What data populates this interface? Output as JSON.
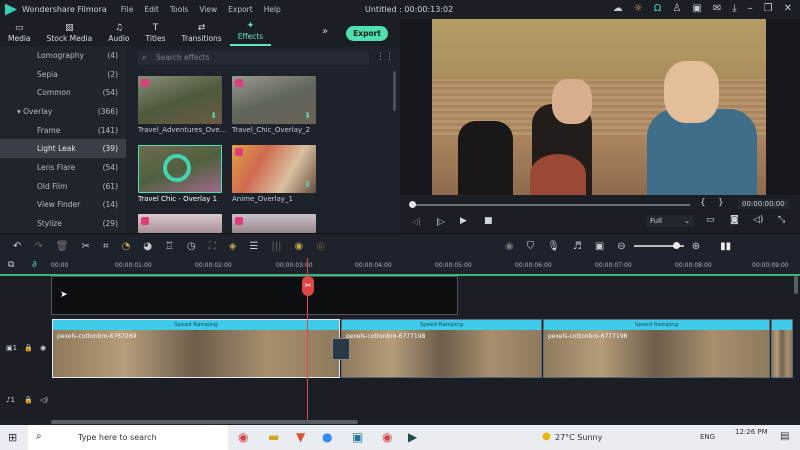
{
  "app": {
    "name": "Wondershare Filmora",
    "title": "Untitled : 00:00:13:02",
    "menu": [
      "File",
      "Edit",
      "Tools",
      "View",
      "Export",
      "Help"
    ]
  },
  "tabs": [
    {
      "label": "Media",
      "icon": "folder-icon"
    },
    {
      "label": "Stock Media",
      "icon": "stock-icon"
    },
    {
      "label": "Audio",
      "icon": "music-icon"
    },
    {
      "label": "Titles",
      "icon": "text-icon"
    },
    {
      "label": "Transitions",
      "icon": "transition-icon"
    },
    {
      "label": "Effects",
      "icon": "effects-icon",
      "active": true
    }
  ],
  "export_label": "Export",
  "categories": [
    {
      "label": "Lomography",
      "count": "(4)"
    },
    {
      "label": "Sepia",
      "count": "(2)"
    },
    {
      "label": "Common",
      "count": "(54)"
    },
    {
      "label": "Overlay",
      "count": "(366)",
      "expanded": true
    },
    {
      "label": "Frame",
      "count": "(141)"
    },
    {
      "label": "Light Leak",
      "count": "(39)",
      "selected": true
    },
    {
      "label": "Lens Flare",
      "count": "(54)"
    },
    {
      "label": "Old Film",
      "count": "(61)"
    },
    {
      "label": "View Finder",
      "count": "(14)"
    },
    {
      "label": "Stylize",
      "count": "(29)"
    }
  ],
  "search_placeholder": "Search effects",
  "effects": [
    {
      "label": "Travel_Adventures_Ove..."
    },
    {
      "label": "Travel_Chic_Overlay_2"
    },
    {
      "label": "Travel Chic - Overlay 1",
      "selected": true
    },
    {
      "label": "Anime_Overlay_1"
    }
  ],
  "preview": {
    "timecode": "00:00:00:00",
    "quality": "Full",
    "progress": 0
  },
  "ruler": [
    "00:00",
    "00:00:01:00",
    "00:00:02:00",
    "00:00:03:00",
    "00:00:04:00",
    "00:00:05:00",
    "00:00:06:00",
    "00:00:07:00",
    "00:00:08:00",
    "00:00:09:00"
  ],
  "clips": [
    {
      "speed": "Speed Ramping",
      "name": "pexels-cottonbro-6767269"
    },
    {
      "speed": "Speed Ramping",
      "name": "pexels-cottonbro-6777198"
    },
    {
      "speed": "Speed Ramping",
      "name": "pexels-cottonbro-6777198"
    }
  ],
  "taskbar": {
    "search": "Type here to search",
    "weather": "27°C  Sunny",
    "lang": "ENG",
    "time": "12:26 PM"
  },
  "colors": {
    "accent": "#4de0b0",
    "playhead": "#e04646",
    "speed_bar": "#3ecbe9"
  }
}
